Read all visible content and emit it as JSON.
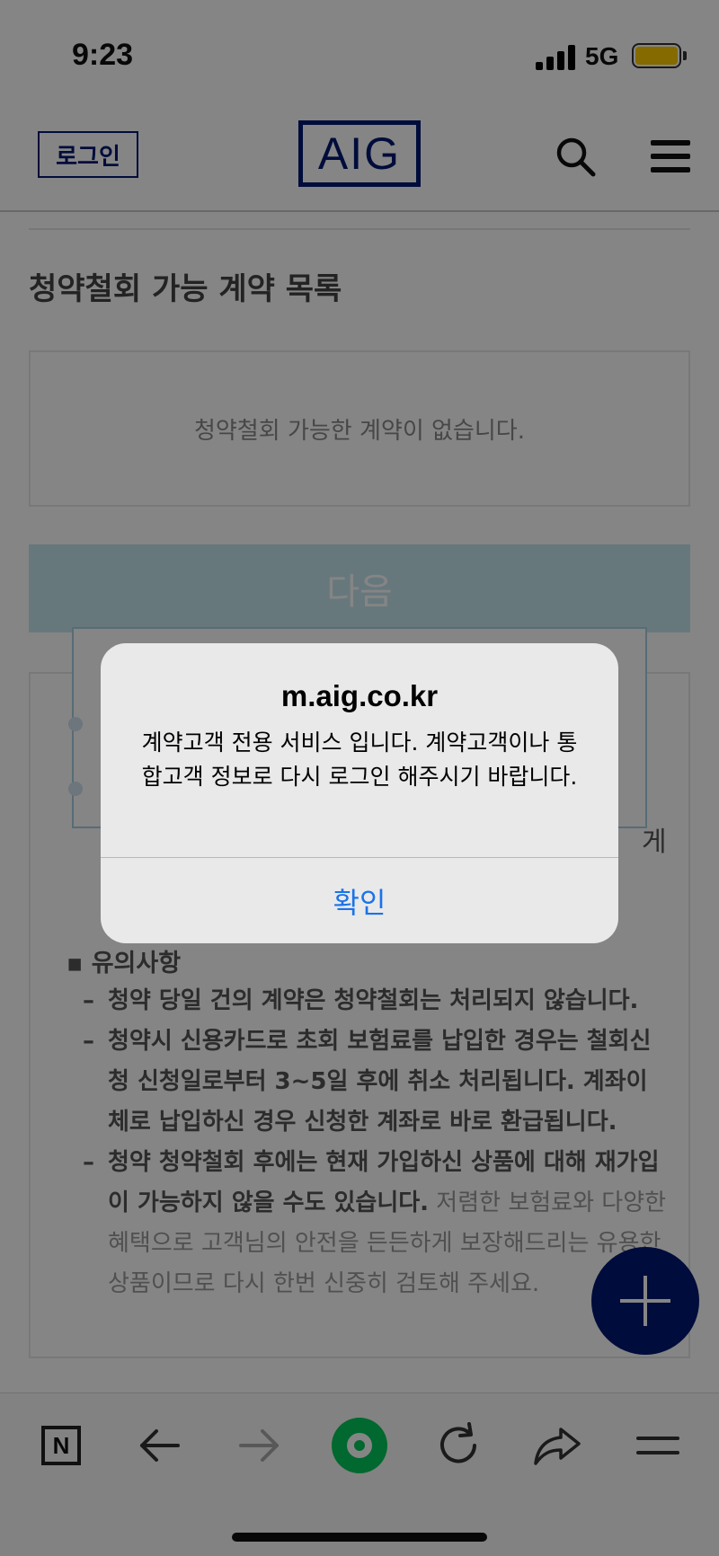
{
  "status_bar": {
    "time": "9:23",
    "network": "5G"
  },
  "header": {
    "login_label": "로그인",
    "logo_text": "AIG"
  },
  "section": {
    "title": "청약철회 가능 계약 목록",
    "empty_message": "청약철회 가능한 계약이 없습니다.",
    "next_label": "다음"
  },
  "notice": {
    "heading": "▪ 유의사항",
    "item1": "청약 당일 건의 계약은 청약철회는 처리되지 않습니다.",
    "item2": "청약시 신용카드로 초회 보험료를 납입한 경우는 철회신청 신청일로부터 3~5일 후에 취소 처리됩니다. 계좌이체로 납입하신 경우 신청한 계좌로 바로 환급됩니다.",
    "item3_bold": "청약 청약철회 후에는 현재 가입하신 상품에 대해 재가입이 가능하지 않을 수도 있습니다.",
    "item3_light": " 저렴한 보험료와 다양한 혜택으로 고객님의 안전을 든든하게 보장해드리는 유용한 상품이므로 다시 한번 신중히 검토해 주세요."
  },
  "toolbar": {
    "n_label": "N"
  },
  "alert": {
    "title": "m.aig.co.kr",
    "message": "계약고객 전용 서비스 입니다. 계약고객이나 통합고객 정보로 다시 로그인 해주시기 바랍니다.",
    "confirm_label": "확인"
  },
  "colors": {
    "brand_navy": "#001871",
    "next_button": "#c5e6f0",
    "alert_action": "#1a73e8",
    "home_green": "#03c75a",
    "battery": "#ffcc00"
  },
  "icons": [
    "search-icon",
    "menu-icon",
    "plus-icon",
    "n-icon",
    "back-arrow-icon",
    "forward-arrow-icon",
    "home-icon",
    "reload-icon",
    "share-icon",
    "tab-menu-icon"
  ]
}
